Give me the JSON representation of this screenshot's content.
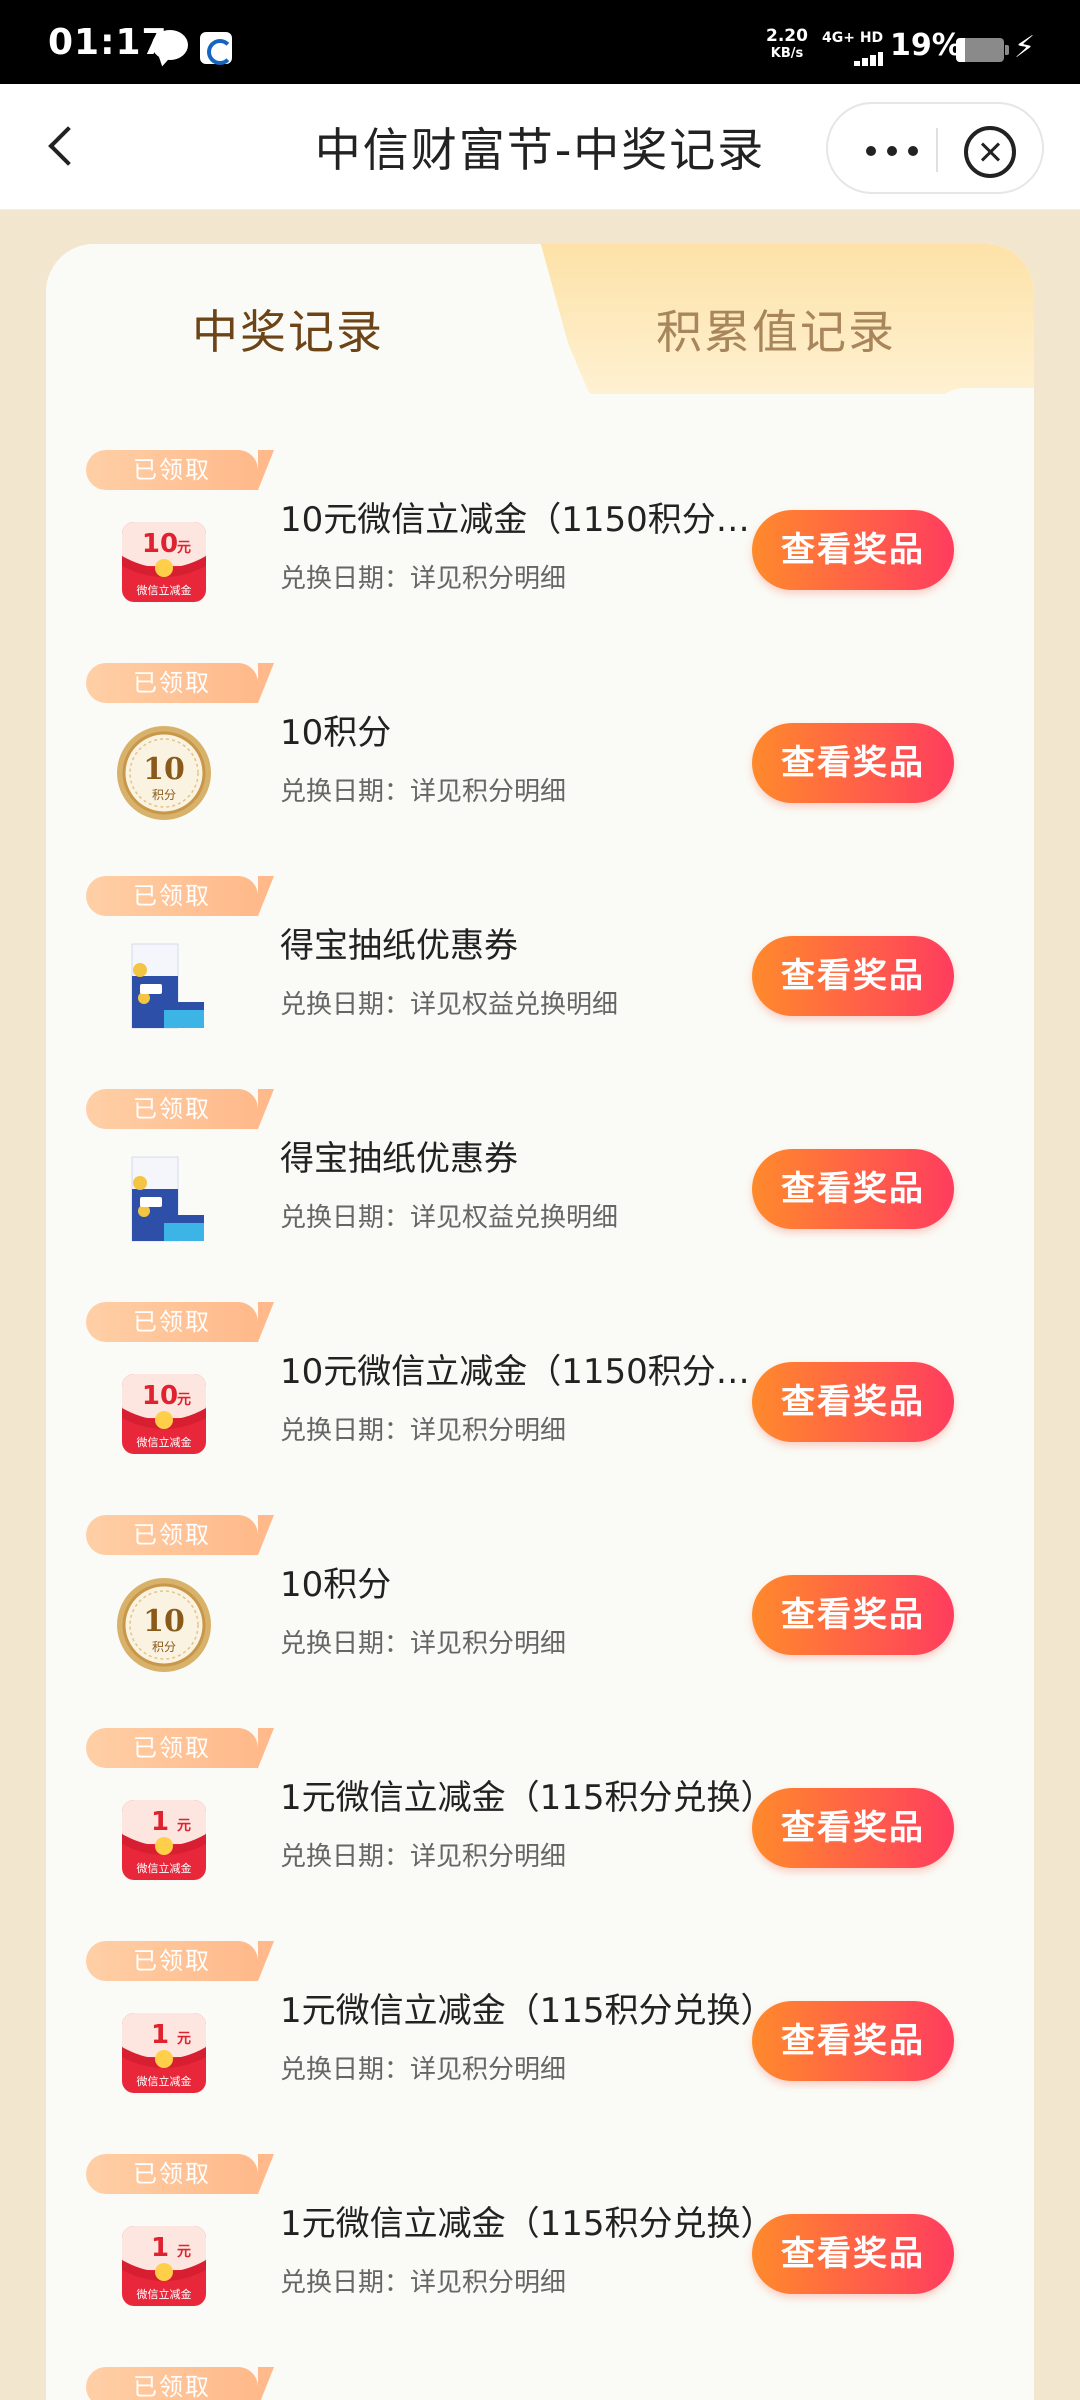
{
  "status_bar": {
    "time": "01:17",
    "speed_value": "2.20",
    "speed_unit": "KB/s",
    "network": "4G+ HD",
    "battery": "19%",
    "battery_fraction": 0.19
  },
  "nav": {
    "title": "中信财富节-中奖记录"
  },
  "tabs": [
    {
      "label": "中奖记录",
      "active": true
    },
    {
      "label": "积累值记录",
      "active": false
    }
  ],
  "records": [
    {
      "badge": "已领取",
      "icon": "wechat-cash-10-icon",
      "name": "10元微信立减金（1150积分兑…",
      "date": "兑换日期：详见积分明细",
      "button": "查看奖品"
    },
    {
      "badge": "已领取",
      "icon": "points-coin-10-icon",
      "name": "10积分",
      "date": "兑换日期：详见积分明细",
      "button": "查看奖品"
    },
    {
      "badge": "已领取",
      "icon": "tissue-pack-icon",
      "name": "得宝抽纸优惠券",
      "date": "兑换日期：详见权益兑换明细",
      "button": "查看奖品"
    },
    {
      "badge": "已领取",
      "icon": "tissue-pack-icon",
      "name": "得宝抽纸优惠券",
      "date": "兑换日期：详见权益兑换明细",
      "button": "查看奖品"
    },
    {
      "badge": "已领取",
      "icon": "wechat-cash-10-icon",
      "name": "10元微信立减金（1150积分兑…",
      "date": "兑换日期：详见积分明细",
      "button": "查看奖品"
    },
    {
      "badge": "已领取",
      "icon": "points-coin-10-icon",
      "name": "10积分",
      "date": "兑换日期：详见积分明细",
      "button": "查看奖品"
    },
    {
      "badge": "已领取",
      "icon": "wechat-cash-1-icon",
      "name": "1元微信立减金（115积分兑换）",
      "date": "兑换日期：详见积分明细",
      "button": "查看奖品"
    },
    {
      "badge": "已领取",
      "icon": "wechat-cash-1-icon",
      "name": "1元微信立减金（115积分兑换）",
      "date": "兑换日期：详见积分明细",
      "button": "查看奖品"
    },
    {
      "badge": "已领取",
      "icon": "wechat-cash-1-icon",
      "name": "1元微信立减金（115积分兑换）",
      "date": "兑换日期：详见积分明细",
      "button": "查看奖品"
    },
    {
      "badge": "已领取"
    }
  ],
  "icon_text": {
    "cash_10_amount": "10",
    "cash_1_amount": "1",
    "cash_unit": "元",
    "cash_caption": "微信立减金",
    "coin_amount": "10",
    "coin_caption": "积分"
  },
  "colors": {
    "button_start": "#ff8a2c",
    "button_end": "#ff3d5e",
    "badge": "#ffc097",
    "page_bg": "#f3e6cf",
    "active_tab_text": "#6d4418",
    "inactive_tab_text": "#a8855a"
  }
}
